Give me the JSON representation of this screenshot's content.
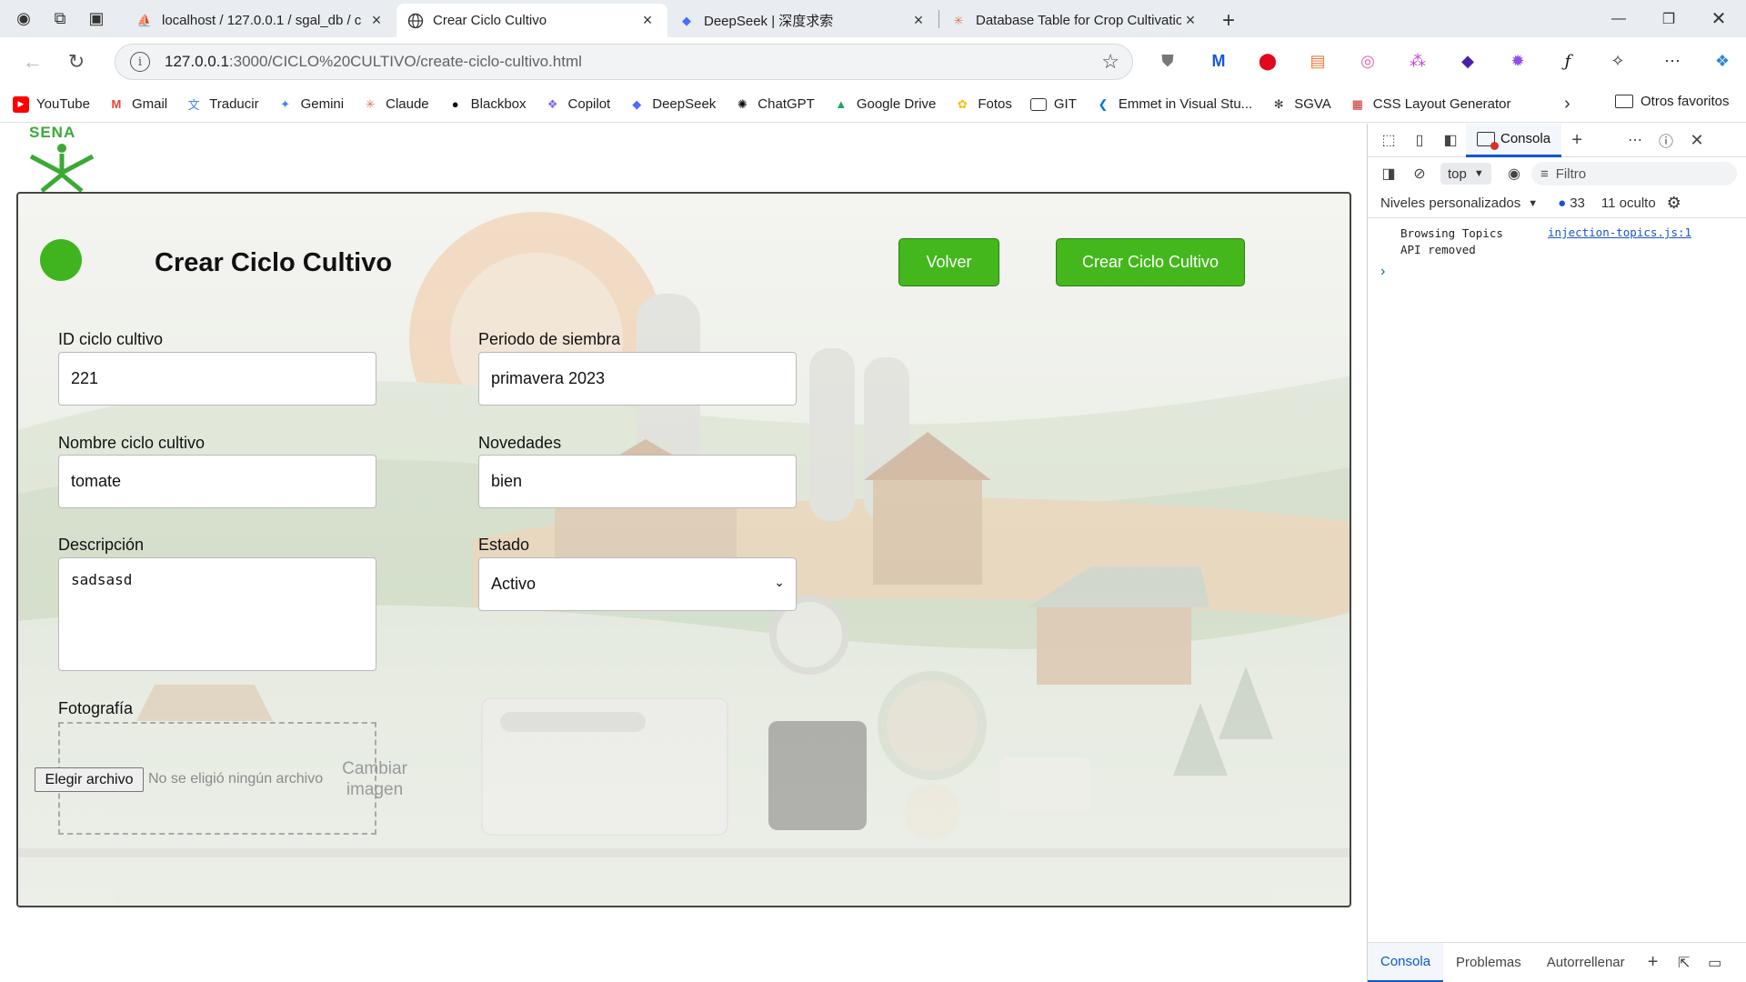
{
  "browser": {
    "tabs": [
      {
        "title": "localhost / 127.0.0.1 / sgal_db / c",
        "favicon": "pma-icon",
        "active": false
      },
      {
        "title": "Crear Ciclo Cultivo",
        "favicon": "globe-icon",
        "active": true
      },
      {
        "title": "DeepSeek | 深度求索",
        "favicon": "deepseek-icon",
        "active": false
      },
      {
        "title": "Database Table for Crop Cultivatio",
        "favicon": "claude-icon",
        "active": false
      }
    ],
    "url_host": "127.0.0.1",
    "url_path": ":3000/CICLO%20CULTIVO/create-ciclo-cultivo.html",
    "bookmarks": [
      {
        "label": "YouTube",
        "color": "#ff0000"
      },
      {
        "label": "Gmail",
        "color": "#ea4335"
      },
      {
        "label": "Traducir",
        "color": "#4285f4"
      },
      {
        "label": "Gemini",
        "color": "#4285f4"
      },
      {
        "label": "Claude",
        "color": "#d97757"
      },
      {
        "label": "Blackbox",
        "color": "#111111"
      },
      {
        "label": "Copilot",
        "color": "#7b61ff"
      },
      {
        "label": "DeepSeek",
        "color": "#4d6bfe"
      },
      {
        "label": "ChatGPT",
        "color": "#111111"
      },
      {
        "label": "Google Drive",
        "color": "#1fa463"
      },
      {
        "label": "Fotos",
        "color": "#fbbc04"
      },
      {
        "label": "GIT",
        "color": "#333333"
      },
      {
        "label": "Emmet in Visual Stu...",
        "color": "#0078d4"
      },
      {
        "label": "SGVA",
        "color": "#333333"
      },
      {
        "label": "CSS Layout Generator",
        "color": "#c62828"
      }
    ],
    "other_bookmarks": "Otros favoritos"
  },
  "page": {
    "logo_text": "SENA",
    "form_title": "Crear Ciclo Cultivo",
    "buttons": {
      "back": "Volver",
      "create": "Crear Ciclo Cultivo"
    },
    "fields": {
      "id_label": "ID ciclo cultivo",
      "id_value": "221",
      "periodo_label": "Periodo de siembra",
      "periodo_value": "primavera 2023",
      "nombre_label": "Nombre ciclo cultivo",
      "nombre_value": "tomate",
      "novedades_label": "Novedades",
      "novedades_value": "bien",
      "descripcion_label": "Descripción",
      "descripcion_value": "sadsasd",
      "estado_label": "Estado",
      "estado_value": "Activo",
      "foto_label": "Fotografía",
      "file_button": "Elegir archivo",
      "file_none": "No se eligió ningún archivo",
      "change_image": "Cambiar imagen"
    },
    "colors": {
      "accent_green": "#44b71d",
      "status_dot": "#3fb41e",
      "sena_green": "#3aaa35"
    }
  },
  "devtools": {
    "console_tab": "Consola",
    "context": "top",
    "filter_placeholder": "Filtro",
    "levels": "Niveles personalizados",
    "message_count": "33",
    "hidden": "11 oculto",
    "log_message_line1": "Browsing Topics",
    "log_message_line2": "API removed",
    "log_source": "injection-topics.js:1",
    "bottom_tabs": [
      "Consola",
      "Problemas",
      "Autorrellenar"
    ]
  }
}
